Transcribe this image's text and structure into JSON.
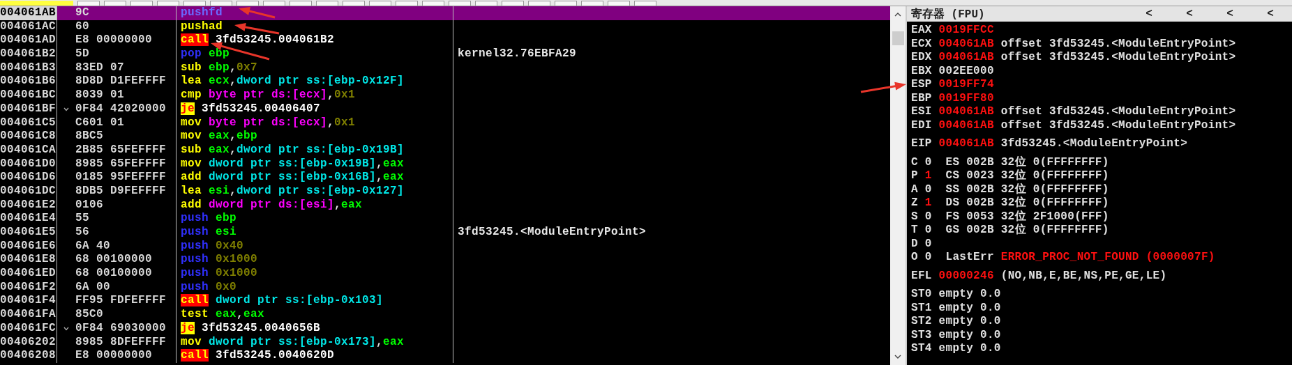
{
  "disassembly": {
    "rows": [
      {
        "address": "004061AB",
        "bytes": "9C",
        "jump_mark": false,
        "selected": true,
        "instruction": [
          {
            "text": "pushfd",
            "kind": "push"
          }
        ]
      },
      {
        "address": "004061AC",
        "bytes": "60",
        "jump_mark": false,
        "selected": false,
        "instruction": [
          {
            "text": "pushad",
            "kind": "mn"
          }
        ]
      },
      {
        "address": "004061AD",
        "bytes": "E8 00000000",
        "jump_mark": false,
        "selected": false,
        "instruction": [
          {
            "text": "call",
            "kind": "call"
          },
          {
            "text": " 3fd53245.004061B2",
            "kind": "addr"
          }
        ]
      },
      {
        "address": "004061B2",
        "bytes": "5D",
        "jump_mark": false,
        "selected": false,
        "instruction": [
          {
            "text": "pop",
            "kind": "push"
          },
          {
            "text": " ebp",
            "kind": "reg"
          }
        ],
        "comment": "kernel32.76EBFA29"
      },
      {
        "address": "004061B3",
        "bytes": "83ED 07",
        "jump_mark": false,
        "selected": false,
        "instruction": [
          {
            "text": "sub",
            "kind": "mn"
          },
          {
            "text": " ebp",
            "kind": "reg"
          },
          {
            "text": ",",
            "kind": "p"
          },
          {
            "text": "0x7",
            "kind": "imm"
          }
        ]
      },
      {
        "address": "004061B6",
        "bytes": "8D8D D1FEFFFF",
        "jump_mark": false,
        "selected": false,
        "instruction": [
          {
            "text": "lea",
            "kind": "mn"
          },
          {
            "text": " ecx",
            "kind": "reg"
          },
          {
            "text": ",",
            "kind": "p"
          },
          {
            "text": "dword ptr ss:[ebp-0x12F]",
            "kind": "mem"
          }
        ]
      },
      {
        "address": "004061BC",
        "bytes": "8039 01",
        "jump_mark": false,
        "selected": false,
        "instruction": [
          {
            "text": "cmp",
            "kind": "mn"
          },
          {
            "text": " byte ptr ds:[ecx]",
            "kind": "bptr"
          },
          {
            "text": ",",
            "kind": "p"
          },
          {
            "text": "0x1",
            "kind": "imm"
          }
        ]
      },
      {
        "address": "004061BF",
        "bytes": "0F84 42020000",
        "jump_mark": true,
        "selected": false,
        "instruction": [
          {
            "text": "je",
            "kind": "jcc"
          },
          {
            "text": " 3fd53245.00406407",
            "kind": "addr"
          }
        ]
      },
      {
        "address": "004061C5",
        "bytes": "C601 01",
        "jump_mark": false,
        "selected": false,
        "instruction": [
          {
            "text": "mov",
            "kind": "mn"
          },
          {
            "text": " byte ptr ds:[ecx]",
            "kind": "bptr"
          },
          {
            "text": ",",
            "kind": "p"
          },
          {
            "text": "0x1",
            "kind": "imm"
          }
        ]
      },
      {
        "address": "004061C8",
        "bytes": "8BC5",
        "jump_mark": false,
        "selected": false,
        "instruction": [
          {
            "text": "mov",
            "kind": "mn"
          },
          {
            "text": " eax",
            "kind": "reg"
          },
          {
            "text": ",",
            "kind": "p"
          },
          {
            "text": "ebp",
            "kind": "reg"
          }
        ]
      },
      {
        "address": "004061CA",
        "bytes": "2B85 65FEFFFF",
        "jump_mark": false,
        "selected": false,
        "instruction": [
          {
            "text": "sub",
            "kind": "mn"
          },
          {
            "text": " eax",
            "kind": "reg"
          },
          {
            "text": ",",
            "kind": "p"
          },
          {
            "text": "dword ptr ss:[ebp-0x19B]",
            "kind": "mem"
          }
        ]
      },
      {
        "address": "004061D0",
        "bytes": "8985 65FEFFFF",
        "jump_mark": false,
        "selected": false,
        "instruction": [
          {
            "text": "mov",
            "kind": "mn"
          },
          {
            "text": " dword ptr ss:[ebp-0x19B]",
            "kind": "mem"
          },
          {
            "text": ",",
            "kind": "p"
          },
          {
            "text": "eax",
            "kind": "reg"
          }
        ]
      },
      {
        "address": "004061D6",
        "bytes": "0185 95FEFFFF",
        "jump_mark": false,
        "selected": false,
        "instruction": [
          {
            "text": "add",
            "kind": "mn"
          },
          {
            "text": " dword ptr ss:[ebp-0x16B]",
            "kind": "mem"
          },
          {
            "text": ",",
            "kind": "p"
          },
          {
            "text": "eax",
            "kind": "reg"
          }
        ]
      },
      {
        "address": "004061DC",
        "bytes": "8DB5 D9FEFFFF",
        "jump_mark": false,
        "selected": false,
        "instruction": [
          {
            "text": "lea",
            "kind": "mn"
          },
          {
            "text": " esi",
            "kind": "reg"
          },
          {
            "text": ",",
            "kind": "p"
          },
          {
            "text": "dword ptr ss:[ebp-0x127]",
            "kind": "mem"
          }
        ]
      },
      {
        "address": "004061E2",
        "bytes": "0106",
        "jump_mark": false,
        "selected": false,
        "instruction": [
          {
            "text": "add",
            "kind": "mn"
          },
          {
            "text": " dword ptr ds:[esi]",
            "kind": "bptr"
          },
          {
            "text": ",",
            "kind": "p"
          },
          {
            "text": "eax",
            "kind": "reg"
          }
        ]
      },
      {
        "address": "004061E4",
        "bytes": "55",
        "jump_mark": false,
        "selected": false,
        "instruction": [
          {
            "text": "push",
            "kind": "push"
          },
          {
            "text": " ebp",
            "kind": "reg"
          }
        ]
      },
      {
        "address": "004061E5",
        "bytes": "56",
        "jump_mark": false,
        "selected": false,
        "instruction": [
          {
            "text": "push",
            "kind": "push"
          },
          {
            "text": " esi",
            "kind": "reg"
          }
        ],
        "comment": "3fd53245.<ModuleEntryPoint>"
      },
      {
        "address": "004061E6",
        "bytes": "6A 40",
        "jump_mark": false,
        "selected": false,
        "instruction": [
          {
            "text": "push",
            "kind": "push"
          },
          {
            "text": " 0x40",
            "kind": "imm"
          }
        ]
      },
      {
        "address": "004061E8",
        "bytes": "68 00100000",
        "jump_mark": false,
        "selected": false,
        "instruction": [
          {
            "text": "push",
            "kind": "push"
          },
          {
            "text": " 0x1000",
            "kind": "imm"
          }
        ]
      },
      {
        "address": "004061ED",
        "bytes": "68 00100000",
        "jump_mark": false,
        "selected": false,
        "instruction": [
          {
            "text": "push",
            "kind": "push"
          },
          {
            "text": " 0x1000",
            "kind": "imm"
          }
        ]
      },
      {
        "address": "004061F2",
        "bytes": "6A 00",
        "jump_mark": false,
        "selected": false,
        "instruction": [
          {
            "text": "push",
            "kind": "push"
          },
          {
            "text": " 0x0",
            "kind": "imm"
          }
        ]
      },
      {
        "address": "004061F4",
        "bytes": "FF95 FDFEFFFF",
        "jump_mark": false,
        "selected": false,
        "instruction": [
          {
            "text": "call",
            "kind": "call"
          },
          {
            "text": " dword ptr ss:[ebp-0x103]",
            "kind": "mem"
          }
        ]
      },
      {
        "address": "004061FA",
        "bytes": "85C0",
        "jump_mark": false,
        "selected": false,
        "instruction": [
          {
            "text": "test",
            "kind": "mn"
          },
          {
            "text": " eax",
            "kind": "reg"
          },
          {
            "text": ",",
            "kind": "p"
          },
          {
            "text": "eax",
            "kind": "reg"
          }
        ]
      },
      {
        "address": "004061FC",
        "bytes": "0F84 69030000",
        "jump_mark": true,
        "selected": false,
        "instruction": [
          {
            "text": "je",
            "kind": "jcc"
          },
          {
            "text": " 3fd53245.0040656B",
            "kind": "addr"
          }
        ]
      },
      {
        "address": "00406202",
        "bytes": "8985 8DFEFFFF",
        "jump_mark": false,
        "selected": false,
        "instruction": [
          {
            "text": "mov",
            "kind": "mn"
          },
          {
            "text": " dword ptr ss:[ebp-0x173]",
            "kind": "mem"
          },
          {
            "text": ",",
            "kind": "p"
          },
          {
            "text": "eax",
            "kind": "reg"
          }
        ]
      },
      {
        "address": "00406208",
        "bytes": "E8 00000000",
        "jump_mark": false,
        "selected": false,
        "instruction": [
          {
            "text": "call",
            "kind": "call"
          },
          {
            "text": " 3fd53245.0040620D",
            "kind": "addr"
          }
        ]
      }
    ]
  },
  "registers": {
    "title": "寄存器 (FPU)",
    "buttons": [
      "<",
      "<",
      "<",
      "<"
    ],
    "groups": [
      {
        "lines": [
          [
            {
              "text": "EAX ",
              "kind": "n"
            },
            {
              "text": "0019FFCC",
              "kind": "chg"
            }
          ],
          [
            {
              "text": "ECX ",
              "kind": "n"
            },
            {
              "text": "004061AB",
              "kind": "chg"
            },
            {
              "text": " offset 3fd53245.<ModuleEntryPoint>",
              "kind": "n"
            }
          ],
          [
            {
              "text": "EDX ",
              "kind": "n"
            },
            {
              "text": "004061AB",
              "kind": "chg"
            },
            {
              "text": " offset 3fd53245.<ModuleEntryPoint>",
              "kind": "n"
            }
          ],
          [
            {
              "text": "EBX 002EE000",
              "kind": "n"
            }
          ],
          [
            {
              "text": "ESP ",
              "kind": "n"
            },
            {
              "text": "0019FF74",
              "kind": "chg"
            }
          ],
          [
            {
              "text": "EBP ",
              "kind": "n"
            },
            {
              "text": "0019FF80",
              "kind": "chg"
            }
          ],
          [
            {
              "text": "ESI ",
              "kind": "n"
            },
            {
              "text": "004061AB",
              "kind": "chg"
            },
            {
              "text": " offset 3fd53245.<ModuleEntryPoint>",
              "kind": "n"
            }
          ],
          [
            {
              "text": "EDI ",
              "kind": "n"
            },
            {
              "text": "004061AB",
              "kind": "chg"
            },
            {
              "text": " offset 3fd53245.<ModuleEntryPoint>",
              "kind": "n"
            }
          ]
        ]
      },
      {
        "lines": [
          [
            {
              "text": "EIP ",
              "kind": "n"
            },
            {
              "text": "004061AB",
              "kind": "chg"
            },
            {
              "text": " 3fd53245.<ModuleEntryPoint>",
              "kind": "n"
            }
          ]
        ]
      },
      {
        "lines": [
          [
            {
              "text": "C 0  ES 002B 32位 0(FFFFFFFF)",
              "kind": "n"
            }
          ],
          [
            {
              "text": "P ",
              "kind": "n"
            },
            {
              "text": "1",
              "kind": "chg"
            },
            {
              "text": "  CS 0023 32位 0(FFFFFFFF)",
              "kind": "n"
            }
          ],
          [
            {
              "text": "A 0  SS 002B 32位 0(FFFFFFFF)",
              "kind": "n"
            }
          ],
          [
            {
              "text": "Z ",
              "kind": "n"
            },
            {
              "text": "1",
              "kind": "chg"
            },
            {
              "text": "  DS 002B 32位 0(FFFFFFFF)",
              "kind": "n"
            }
          ],
          [
            {
              "text": "S 0  FS 0053 32位 2F1000(FFF)",
              "kind": "n"
            }
          ],
          [
            {
              "text": "T 0  GS 002B 32位 0(FFFFFFFF)",
              "kind": "n"
            }
          ],
          [
            {
              "text": "D 0",
              "kind": "n"
            }
          ],
          [
            {
              "text": "O 0  LastErr ",
              "kind": "n"
            },
            {
              "text": "ERROR_PROC_NOT_FOUND (0000007F)",
              "kind": "chg"
            }
          ]
        ]
      },
      {
        "lines": [
          [
            {
              "text": "EFL ",
              "kind": "n"
            },
            {
              "text": "00000246",
              "kind": "chg"
            },
            {
              "text": " (NO,NB,E,BE,NS,PE,GE,LE)",
              "kind": "n"
            }
          ]
        ]
      },
      {
        "lines": [
          [
            {
              "text": "ST0 empty 0.0",
              "kind": "n"
            }
          ],
          [
            {
              "text": "ST1 empty 0.0",
              "kind": "n"
            }
          ],
          [
            {
              "text": "ST2 empty 0.0",
              "kind": "n"
            }
          ],
          [
            {
              "text": "ST3 empty 0.0",
              "kind": "n"
            }
          ],
          [
            {
              "text": "ST4 empty 0.0",
              "kind": "n"
            }
          ]
        ]
      }
    ]
  }
}
